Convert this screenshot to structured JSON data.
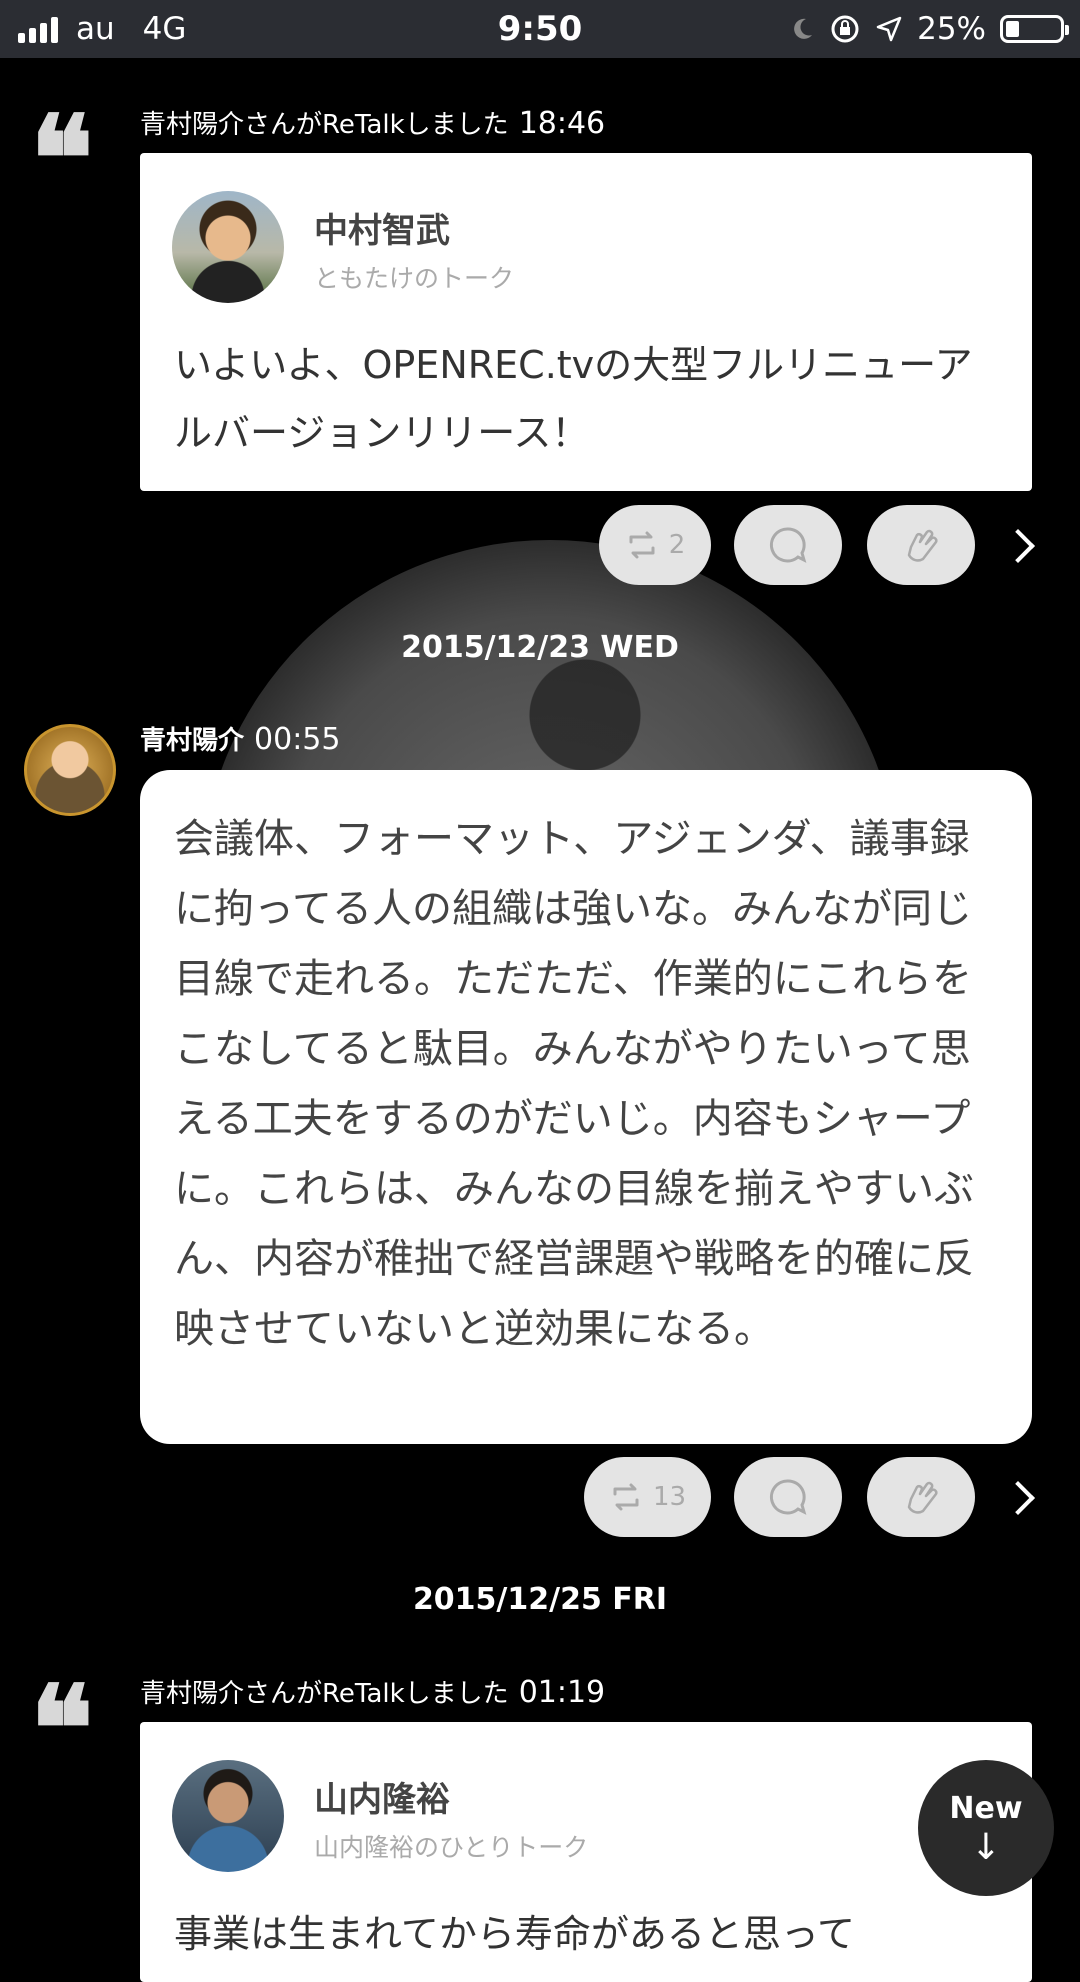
{
  "status_bar": {
    "carrier": "au",
    "network": "4G",
    "time": "9:50",
    "battery": "25%",
    "battery_level": 0.25
  },
  "feed": {
    "post1": {
      "retalk_by": "青村陽介さんがReTalkしました",
      "time": "18:46",
      "author": "中村智武",
      "channel": "ともたけのトーク",
      "text": "いよいよ、OPENREC.tvの大型フルリニューアルバージョンリリース！",
      "retalk_count": "2"
    },
    "date1": "2015/12/23 WED",
    "post2": {
      "author": "青村陽介",
      "time": "00:55",
      "text": "会議体、フォーマット、アジェンダ、議事録に拘ってる人の組織は強いな。みんなが同じ目線で走れる。ただただ、作業的にこれらをこなしてると駄目。みんながやりたいって思える工夫をするのがだいじ。内容もシャープに。これらは、みんなの目線を揃えやすいぶん、内容が稚拙で経営課題や戦略を的確に反映させていないと逆効果になる。",
      "retalk_count": "13"
    },
    "date2": "2015/12/25 FRI",
    "post3": {
      "retalk_by": "青村陽介さんがReTalkしました",
      "time": "01:19",
      "author": "山内隆裕",
      "channel": "山内隆裕のひとりトーク",
      "text": "事業は生まれてから寿命があると思って"
    }
  },
  "new_button": {
    "label": "New"
  },
  "icons": {
    "retalk": "retalk-icon",
    "comment": "comment-icon",
    "clap": "clap-icon",
    "more": "chevron-right-icon",
    "quote": "quote-icon"
  }
}
